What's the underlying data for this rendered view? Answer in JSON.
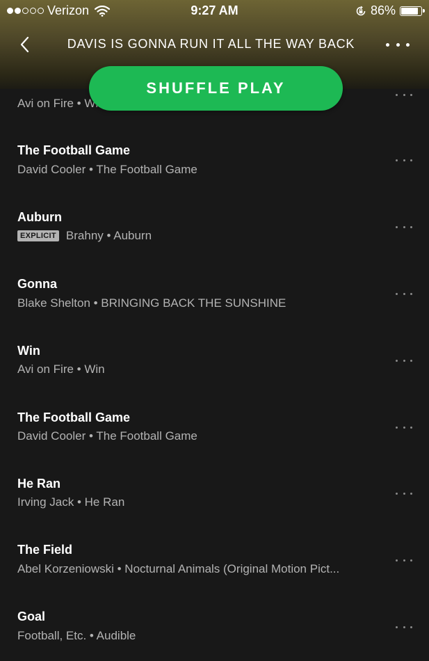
{
  "status_bar": {
    "carrier": "Verizon",
    "time": "9:27 AM",
    "battery_percent": "86%",
    "battery_level": 0.86,
    "signal_bars_filled": 2,
    "signal_bars_total": 5
  },
  "header": {
    "back_icon": "chevron-left-icon",
    "title": "DAVIS IS GONNA RUN IT ALL THE WAY BACK",
    "more_icon": "more-horizontal-icon"
  },
  "shuffle_button": {
    "label": "SHUFFLE PLAY",
    "color": "#1db954"
  },
  "tracks": [
    {
      "title": "",
      "subtitle": "Avi on Fire • Win",
      "explicit": false
    },
    {
      "title": "The Football Game",
      "subtitle": "David Cooler • The Football Game",
      "explicit": false
    },
    {
      "title": "Auburn",
      "subtitle": "Brahny • Auburn",
      "explicit": true,
      "explicit_label": "EXPLICIT"
    },
    {
      "title": "Gonna",
      "subtitle": "Blake Shelton • BRINGING BACK THE SUNSHINE",
      "explicit": false
    },
    {
      "title": "Win",
      "subtitle": "Avi on Fire • Win",
      "explicit": false
    },
    {
      "title": "The Football Game",
      "subtitle": "David Cooler • The Football Game",
      "explicit": false
    },
    {
      "title": "He Ran",
      "subtitle": "Irving Jack • He Ran",
      "explicit": false
    },
    {
      "title": "The Field",
      "subtitle": "Abel Korzeniowski • Nocturnal Animals (Original Motion Pict...",
      "explicit": false
    },
    {
      "title": "Goal",
      "subtitle": "Football, Etc. • Audible",
      "explicit": false
    }
  ]
}
